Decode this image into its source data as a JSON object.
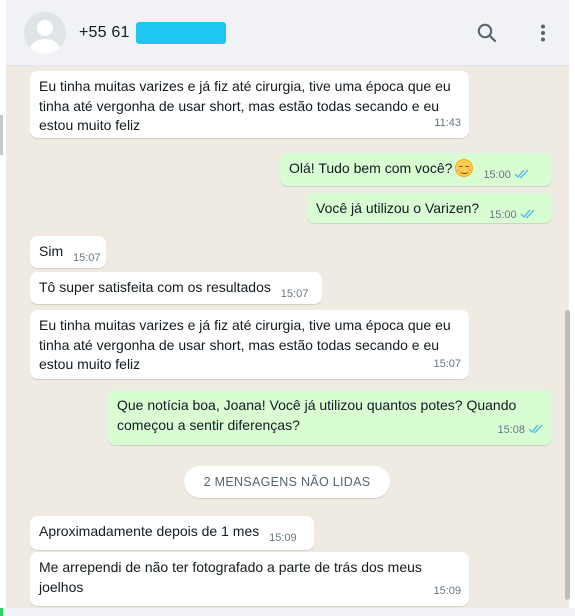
{
  "header": {
    "contact_name": "+55 61",
    "icons": {
      "search": "search-icon",
      "menu": "vertical-dots-menu-icon",
      "avatar": "default-avatar-icon"
    }
  },
  "colors": {
    "header_bg": "#f0f2f5",
    "chat_bg": "#efeae2",
    "incoming_bubble": "#ffffff",
    "outgoing_bubble": "#d9fdd3",
    "read_ticks": "#53bdeb",
    "redaction": "#1fc6f2"
  },
  "messages": [
    {
      "dir": "in",
      "text": "Eu tinha muitas varizes e já fiz até cirurgia, tive uma época que eu tinha até vergonha de usar short, mas estão todas secando e eu estou muito feliz",
      "time": "11:43"
    },
    {
      "dir": "out",
      "text": "Olá! Tudo bem com você?",
      "emoji": "smiling-face-emoji",
      "time": "15:00",
      "status": "read"
    },
    {
      "dir": "out",
      "text": "Você já utilizou o Varizen?",
      "time": "15:00",
      "status": "read"
    },
    {
      "dir": "in",
      "text": "Sim",
      "time": "15:07"
    },
    {
      "dir": "in",
      "text": "Tô super satisfeita com os resultados",
      "time": "15:07"
    },
    {
      "dir": "in",
      "text": "Eu tinha muitas varizes e já fiz até cirurgia, tive uma época que eu tinha até vergonha de usar short, mas estão todas secando e eu estou muito feliz",
      "time": "15:07"
    },
    {
      "dir": "out",
      "text": "Que notícia boa, Joana! Você já utilizou quantos potes? Quando começou a sentir diferenças?",
      "time": "15:08",
      "status": "read"
    },
    {
      "dir": "in",
      "text": "Aproximadamente depois de 1 mes",
      "time": "15:09"
    },
    {
      "dir": "in",
      "text": "Me arrependi de não ter fotografado a parte de trás dos meus joelhos",
      "time": "15:09"
    }
  ],
  "unread_banner": "2 MENSAGENS NÃO LIDAS"
}
